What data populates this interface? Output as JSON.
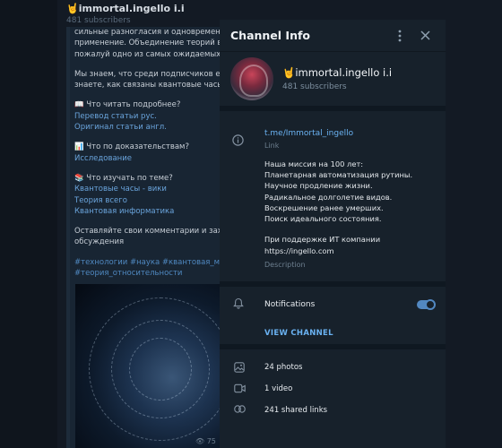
{
  "chat": {
    "title": "immortal.ingello i.i",
    "subscribers": "481 subscribers",
    "lines": [
      {
        "text": "сильные разногласия и одновременно",
        "kind": "text"
      },
      {
        "text": "применение. Объединение теорий в т.",
        "kind": "text"
      },
      {
        "text": "пожалуй одно из самых ожидаемых соб",
        "kind": "text"
      },
      {
        "text": "",
        "kind": "gap"
      },
      {
        "text": "Мы знаем, что среди подписчиков есть",
        "kind": "text"
      },
      {
        "text": "знаете, как связаны квантовые часы и б",
        "kind": "text"
      },
      {
        "text": "",
        "kind": "gap"
      },
      {
        "text": "📖 Что читать подробнее?",
        "kind": "text"
      },
      {
        "text": "Перевод статьи рус.",
        "kind": "link"
      },
      {
        "text": "Оригинал статьи англ.",
        "kind": "link"
      },
      {
        "text": "",
        "kind": "gap"
      },
      {
        "text": "📊 Что по доказательствам?",
        "kind": "text"
      },
      {
        "text": "Исследование",
        "kind": "link"
      },
      {
        "text": "",
        "kind": "gap"
      },
      {
        "text": "📚 Что изучать по теме?",
        "kind": "text"
      },
      {
        "text": "Квантовые часы - вики",
        "kind": "link"
      },
      {
        "text": "Теория всего",
        "kind": "link"
      },
      {
        "text": "Квантовая информатика",
        "kind": "link"
      },
      {
        "text": "",
        "kind": "gap"
      },
      {
        "text": "Оставляйте свои комментарии и заход",
        "kind": "text"
      },
      {
        "text": "обсуждения",
        "kind": "text"
      },
      {
        "text": "",
        "kind": "gap"
      },
      {
        "text": "#технологии #наука #квантовая_механ",
        "kind": "tag"
      },
      {
        "text": "#теория_относительности",
        "kind": "tag"
      }
    ],
    "views": "75"
  },
  "dialog": {
    "title": "Channel Info",
    "more_icon": "more-vertical-icon",
    "close_icon": "close-icon",
    "channel_name": "🤘immortal.ingello i.i",
    "channel_subscribers": "481 subscribers",
    "link": "t.me/Immortal_ingello",
    "link_caption": "Link",
    "description_lines": [
      "Наша миссия на 100 лет:",
      "Планетарная автоматизация рутины.",
      "Научное продление жизни.",
      "Радикальное долголетие видов.",
      "Воскрешение ранее умерших.",
      "Поиск идеального состояния.",
      "",
      "При поддержке ИТ компании"
    ],
    "description_url": "https://ingello.com",
    "description_caption": "Description",
    "notifications_label": "Notifications",
    "notifications_on": true,
    "view_channel_label": "VIEW CHANNEL",
    "media": [
      {
        "icon": "photo-icon",
        "label": "24 photos"
      },
      {
        "icon": "video-icon",
        "label": "1 video"
      },
      {
        "icon": "link-icon",
        "label": "241 shared links"
      }
    ],
    "colors": {
      "accent": "#5288c1",
      "link": "#6ab2f2",
      "panel": "#17212b"
    }
  }
}
